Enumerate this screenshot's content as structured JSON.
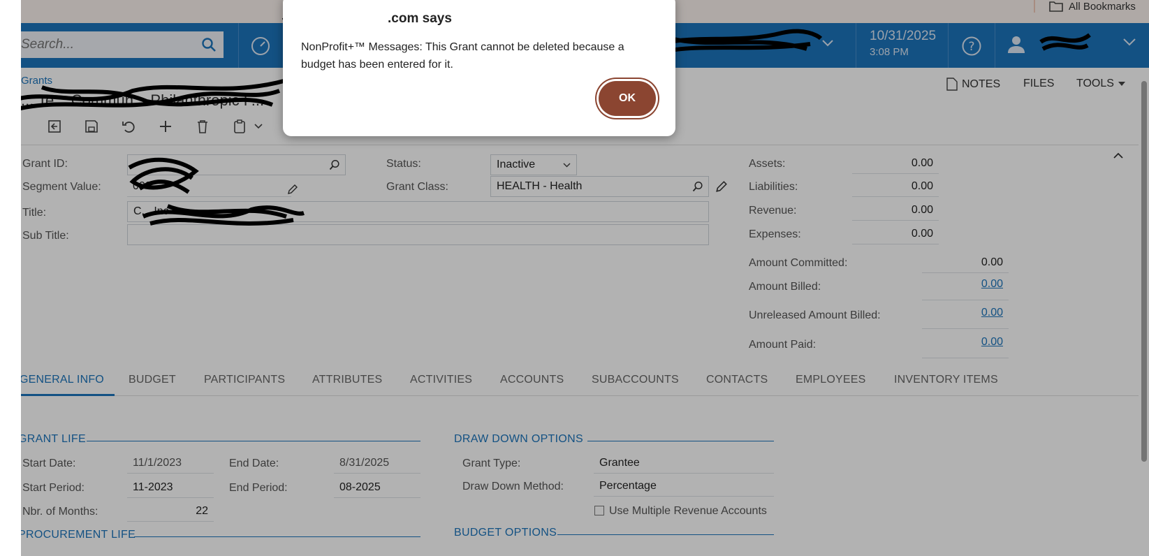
{
  "bookmarks": {
    "all_bookmarks": "All Bookmarks"
  },
  "topnav": {
    "search_placeholder": "Search...",
    "date": "10/31/2025",
    "time": "3:08 PM"
  },
  "page": {
    "breadcrumb": "Grants",
    "title_partial": "... Te... Commun... Philanthropic F...",
    "right_tools": {
      "notes": "NOTES",
      "files": "FILES",
      "tools": "TOOLS"
    }
  },
  "form": {
    "grant_id_label": "Grant ID:",
    "segment_value_label": "Segment Value:",
    "segment_value": "000",
    "title_label": "Title:",
    "title_value": "C... Inc",
    "subtitle_label": "Sub Title:",
    "status_label": "Status:",
    "status_value": "Inactive",
    "grant_class_label": "Grant Class:",
    "grant_class_value": "HEALTH - Health",
    "assets_label": "Assets:",
    "assets": "0.00",
    "liabilities_label": "Liabilities:",
    "liabilities": "0.00",
    "revenue_label": "Revenue:",
    "revenue": "0.00",
    "expenses_label": "Expenses:",
    "expenses": "0.00",
    "amount_committed_label": "Amount Committed:",
    "amount_committed": "0.00",
    "amount_billed_label": "Amount Billed:",
    "amount_billed": "0.00",
    "unreleased_label": "Unreleased Amount Billed:",
    "unreleased": "0.00",
    "amount_paid_label": "Amount Paid:",
    "amount_paid": "0.00"
  },
  "tabs": [
    "GENERAL INFO",
    "BUDGET",
    "PARTICIPANTS",
    "ATTRIBUTES",
    "ACTIVITIES",
    "ACCOUNTS",
    "SUBACCOUNTS",
    "CONTACTS",
    "EMPLOYEES",
    "INVENTORY ITEMS"
  ],
  "general": {
    "grant_life_header": "GRANT LIFE",
    "start_date_label": "Start Date:",
    "start_date": "11/1/2023",
    "end_date_label": "End Date:",
    "end_date": "8/31/2025",
    "start_period_label": "Start Period:",
    "start_period": "11-2023",
    "end_period_label": "End Period:",
    "end_period": "08-2025",
    "months_label": "Nbr. of Months:",
    "months": "22",
    "procurement_header": "PROCUREMENT LIFE",
    "drawdown_header": "DRAW DOWN OPTIONS",
    "grant_type_label": "Grant Type:",
    "grant_type": "Grantee",
    "method_label": "Draw Down Method:",
    "method": "Percentage",
    "multiple_revenue_label": "Use Multiple Revenue Accounts",
    "budget_options_header": "BUDGET OPTIONS"
  },
  "dialog": {
    "title": ".com says",
    "message": "NonProfit+™ Messages: This Grant cannot be deleted because a budget has been entered for it.",
    "ok_label": "OK"
  }
}
